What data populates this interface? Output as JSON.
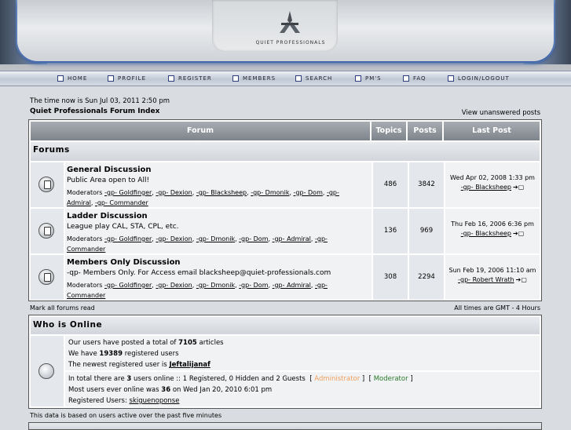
{
  "header": {
    "logo_text": "QUIET PROFESSIONALS"
  },
  "nav": [
    {
      "label": "HOME",
      "icon": "home-icon"
    },
    {
      "label": "PROFILE",
      "icon": "profile-icon"
    },
    {
      "label": "REGISTER",
      "icon": "register-icon"
    },
    {
      "label": "MEMBERS",
      "icon": "members-icon"
    },
    {
      "label": "SEARCH",
      "icon": "search-icon"
    },
    {
      "label": "PM'S",
      "icon": "pm-icon"
    },
    {
      "label": "FAQ",
      "icon": "faq-icon"
    },
    {
      "label": "LOGIN/LOGOUT",
      "icon": "login-icon"
    }
  ],
  "info": {
    "time_now": "The time now is Sun Jul 03, 2011 2:50 pm",
    "forum_index": "Quiet Professionals Forum Index",
    "unanswered": "View unanswered posts"
  },
  "table": {
    "headers": {
      "forum": "Forum",
      "topics": "Topics",
      "posts": "Posts",
      "last_post": "Last Post"
    },
    "category": "Forums",
    "rows": [
      {
        "name": "General Discussion",
        "desc": "Public Area open to All!",
        "mods_label": "Moderators",
        "mods": [
          "-gp- Goldfinger",
          "-gp- Dexion",
          "-gp- Blacksheep",
          "-gp- Dmonik",
          "-gp- Dom",
          "-gp- Admiral",
          "-gp- Commander"
        ],
        "topics": "486",
        "posts": "3842",
        "last_date": "Wed Apr 02, 2008 1:33 pm",
        "last_user": "-gp- Blacksheep"
      },
      {
        "name": "Ladder Discussion",
        "desc": "League play CAL, STA, CPL, etc.",
        "mods_label": "Moderators",
        "mods": [
          "-gp- Goldfinger",
          "-gp- Dexion",
          "-gp- Dmonik",
          "-gp- Dom",
          "-gp- Admiral",
          "-gp- Commander"
        ],
        "topics": "136",
        "posts": "969",
        "last_date": "Thu Feb 16, 2006 6:36 pm",
        "last_user": "-gp- Blacksheep"
      },
      {
        "name": "Members Only Discussion",
        "desc": "-qp- Members Only. For Access email blacksheep@quiet-professionals.com",
        "mods_label": "Moderators",
        "mods": [
          "-gp- Goldfinger",
          "-gp- Dexion",
          "-gp- Dmonik",
          "-gp- Dom",
          "-gp- Admiral",
          "-gp- Commander"
        ],
        "topics": "308",
        "posts": "2294",
        "last_date": "Sun Feb 19, 2006 11:10 am",
        "last_user": "-gp- Robert Wrath"
      }
    ]
  },
  "below_table": {
    "mark_read": "Mark all forums read",
    "timezone": "All times are GMT - 4 Hours"
  },
  "online": {
    "title": "Who is Online",
    "articles_pre": "Our users have posted a total of",
    "articles_count": "7105",
    "articles_post": "articles",
    "users_pre": "We have",
    "users_count": "19389",
    "users_post": "registered users",
    "newest_pre": "The newest registered user is",
    "newest_user": "Jeftalijanaf",
    "total_pre": "In total there are",
    "total_count": "3",
    "total_post": "users online :: 1 Registered, 0 Hidden and 2 Guests",
    "admin_label": "Administrator",
    "mod_label": "Moderator",
    "most_pre": "Most users ever online was",
    "most_count": "36",
    "most_post": "on Wed Jan 20, 2010 6:01 pm",
    "registered_pre": "Registered Users:",
    "registered_user": "skiguenoponse"
  },
  "footer": {
    "note": "This data is based on users active over the past five minutes"
  },
  "colors": {
    "admin": "#f0a060",
    "moderator": "#2a7a2a",
    "header_bar": "#7e848b"
  }
}
